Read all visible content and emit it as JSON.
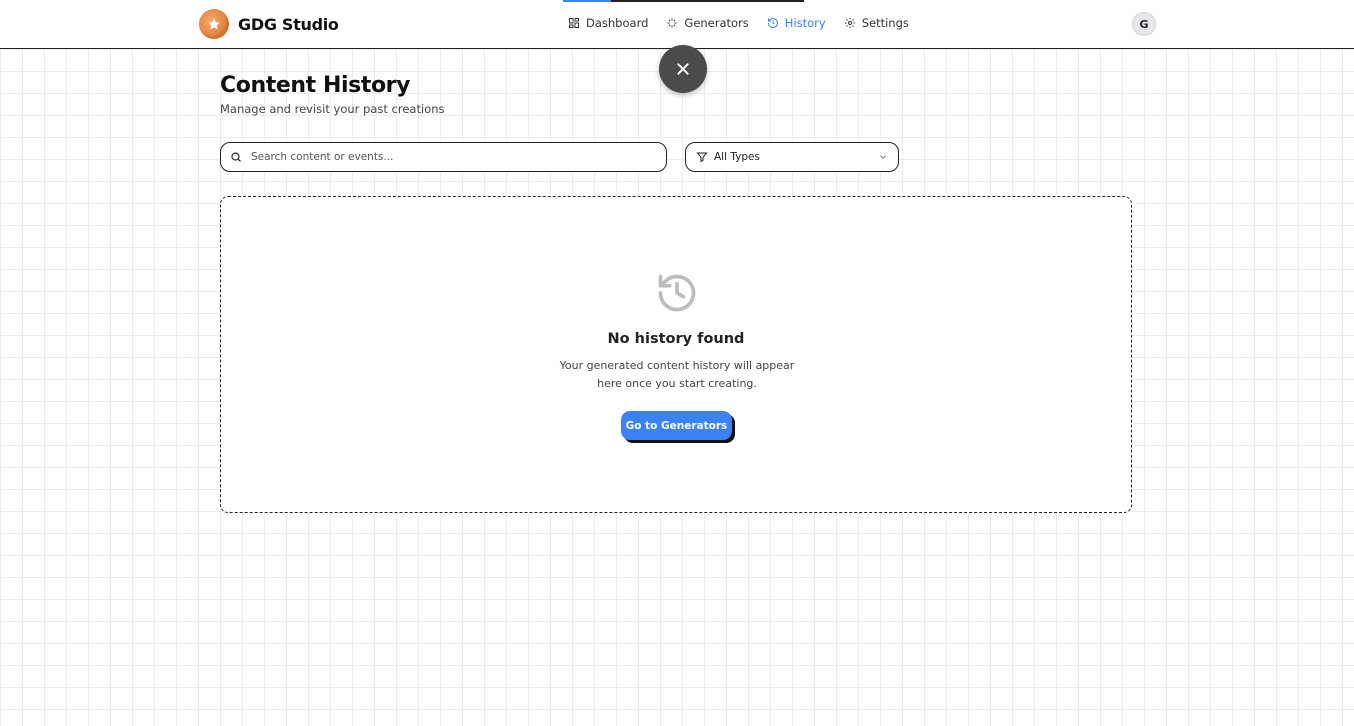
{
  "brand": {
    "name": "GDG Studio",
    "logo_icon": "star-icon"
  },
  "nav": {
    "items": [
      {
        "label": "Dashboard",
        "icon": "dashboard-icon",
        "active": false
      },
      {
        "label": "Generators",
        "icon": "sparkles-icon",
        "active": false
      },
      {
        "label": "History",
        "icon": "history-icon",
        "active": true
      },
      {
        "label": "Settings",
        "icon": "gear-icon",
        "active": false
      }
    ]
  },
  "user": {
    "avatar_initial": "G"
  },
  "page": {
    "title": "Content History",
    "subtitle": "Manage and revisit your past creations"
  },
  "search": {
    "placeholder": "Search content or events...",
    "value": ""
  },
  "filter": {
    "selected": "All Types"
  },
  "empty_state": {
    "title": "No history found",
    "description": "Your generated content history will appear here once you start creating.",
    "button_label": "Go to Generators"
  },
  "colors": {
    "accent": "#3b82f6",
    "close_button": "#4b4b4b",
    "brand_logo": "#e07b3a"
  }
}
